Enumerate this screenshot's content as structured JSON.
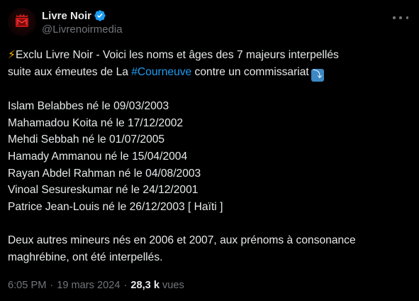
{
  "author": {
    "display_name": "Livre Noir",
    "handle": "@Livrenoirmedia",
    "avatar_icon": "livre-noir-logo",
    "verified_icon": "verified-badge-icon",
    "verified_color": "#1d9bf0"
  },
  "menu": {
    "icon": "more-options-icon"
  },
  "tweet": {
    "intro_emoji": "⚡",
    "intro_text": "Exclu Livre Noir - Voici les noms et âges des 7 majeurs interpellés",
    "line2_before": "suite aux émeutes de La ",
    "hashtag": "#Courneuve",
    "line2_after": " contre un commissariat",
    "arrow_emoji": "⤵",
    "names": [
      "Islam Belabbes né le 09/03/2003",
      "Mahamadou Koita né le 17/12/2002",
      "Mehdi Sebbah né le 01/07/2005",
      "Hamady Ammanou né le 15/04/2004",
      "Rayan Abdel Rahman né le 04/08/2003",
      "Vinoal Sesureskumar né le 24/12/2001",
      "Patrice Jean-Louis né le 26/12/2003 [ Haïti ]"
    ],
    "outro_line1": "Deux autres mineurs nés en 2006 et 2007, aux prénoms à consonance",
    "outro_line2": "maghrébine, ont été interpellés."
  },
  "meta": {
    "time": "6:05 PM",
    "date": "19 mars 2024",
    "separator": "·",
    "views_count": "28,3 k",
    "views_label": "vues"
  },
  "colors": {
    "background": "#000000",
    "text": "#e7e9ea",
    "secondary": "#71767b",
    "link": "#1d9bf0"
  }
}
